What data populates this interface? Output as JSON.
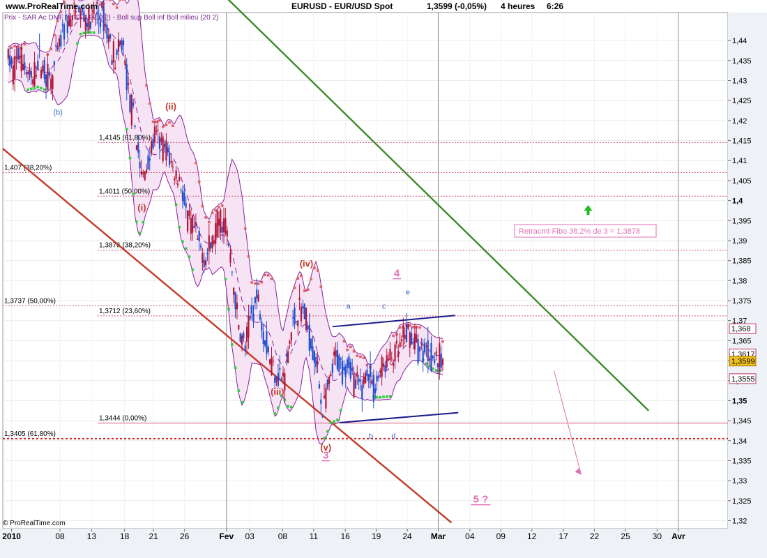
{
  "header": {
    "site": "www.ProRealTime.com",
    "symbol": "EURUSD - EUR/USD Spot",
    "price": "1,3599 (-0,05%)",
    "period": "4 heures",
    "time": "6:26"
  },
  "copyright": "© ProRealTime.com",
  "indicators_label": "Prix - SAR Ac DMF (0,02 0,02 0,2) - Boll sup Boll inf Boll milieu (20 2)",
  "colors": {
    "candle_up": "#1f4fcf",
    "candle_down": "#b0163a",
    "sar_up": "#33cc44",
    "sar_down": "#e0606a",
    "boll_fill": "#f6e4f4",
    "boll_line": "#8a1fa0",
    "channel_green": "#3d8a2a",
    "channel_red": "#c23a2a",
    "wave_label_red": "#c0392b",
    "wave_label_blue": "#3e6fc6",
    "wave_label_pink": "#e06fb4",
    "triangle": "#1a1a8a"
  },
  "chart_data": {
    "type": "candlestick",
    "title": "EURUSD - EUR/USD Spot",
    "timeframe": "4 heures",
    "last_price": 1.3599,
    "change_pct": -0.05,
    "ylim": [
      1.318,
      1.447
    ],
    "grid": true,
    "x_ticks": [
      "2010",
      "08",
      "13",
      "18",
      "21",
      "26",
      "Fev",
      "03",
      "08",
      "11",
      "16",
      "19",
      "24",
      "Mar",
      "04",
      "09",
      "12",
      "17",
      "22",
      "25",
      "30",
      "Avr"
    ],
    "y_ticks": [
      "1,32",
      "1,325",
      "1,33",
      "1,335",
      "1,34",
      "1,345",
      "1,35",
      "1,355",
      "1,36",
      "1,365",
      "1,37",
      "1,375",
      "1,38",
      "1,385",
      "1,39",
      "1,395",
      "1,4",
      "1,405",
      "1,41",
      "1,415",
      "1,42",
      "1,425",
      "1,43",
      "1,435",
      "1,44"
    ],
    "y_ticks_bold": [
      "1,35",
      "1,4"
    ],
    "price_tags": [
      {
        "label": "1,368",
        "value": 1.368
      },
      {
        "label": "1,3617",
        "value": 1.3617
      },
      {
        "label": "1,3599",
        "value": 1.3599,
        "highlight": true
      },
      {
        "label": "1,3555",
        "value": 1.3555
      }
    ],
    "fib_levels": [
      {
        "label": "1,4145 (61,80%)",
        "value": 1.4145,
        "style": "dotted",
        "start": "18"
      },
      {
        "label": "1,407 (38,20%)",
        "value": 1.407,
        "style": "dotted",
        "start": "2010"
      },
      {
        "label": "1,4011 (50,00%)",
        "value": 1.4011,
        "style": "dotted",
        "start": "18"
      },
      {
        "label": "1,3876 (38,20%)",
        "value": 1.3876,
        "style": "dotted",
        "start": "18"
      },
      {
        "label": "1,3737 (50,00%)",
        "value": 1.3737,
        "style": "dotted",
        "start": "2010"
      },
      {
        "label": "1,3712 (23,60%)",
        "value": 1.3712,
        "style": "dotted",
        "start": "18"
      },
      {
        "label": "1,3444 (0,00%)",
        "value": 1.3444,
        "style": "solid",
        "start": "18"
      },
      {
        "label": "1,3405 (61,80%)",
        "value": 1.3405,
        "style": "bold-dotted",
        "start": "2010"
      }
    ],
    "annotation_box": "Retracmt Fibo 38,2% de 3 = 1,3878",
    "wave_labels": [
      {
        "text": "(b)",
        "day": 8,
        "value": 1.4215,
        "color": "blue"
      },
      {
        "text": "(ii)",
        "day": 25.5,
        "value": 1.4228,
        "color": "red"
      },
      {
        "text": "(i)",
        "day": 21,
        "value": 1.3975,
        "color": "red"
      },
      {
        "text": "(iii)",
        "day": 42,
        "value": 1.3515,
        "color": "red"
      },
      {
        "text": "(iv)",
        "day": 46.5,
        "value": 1.3835,
        "color": "red"
      },
      {
        "text": "(v)",
        "day": 49.5,
        "value": 1.3375,
        "color": "red"
      },
      {
        "text": "3",
        "day": 49.5,
        "value": 1.3355,
        "color": "pink",
        "underline": true
      },
      {
        "text": "4",
        "day": 60.5,
        "value": 1.381,
        "color": "pink",
        "underline": true
      },
      {
        "text": "a",
        "day": 53,
        "value": 1.373,
        "color": "blue"
      },
      {
        "text": "b",
        "day": 56.5,
        "value": 1.3405,
        "color": "blue"
      },
      {
        "text": "c",
        "day": 58.5,
        "value": 1.373,
        "color": "blue"
      },
      {
        "text": "d",
        "day": 60,
        "value": 1.3405,
        "color": "blue"
      },
      {
        "text": "e",
        "day": 62.2,
        "value": 1.3765,
        "color": "blue"
      },
      {
        "text": "5 ?",
        "day": 73.5,
        "value": 1.3245,
        "color": "pink",
        "underline": true
      }
    ],
    "trendlines": [
      {
        "name": "upper-channel",
        "from": [
          24,
          1.4655
        ],
        "to": [
          95,
          1.3475
        ],
        "color": "green"
      },
      {
        "name": "lower-channel",
        "from": [
          0,
          1.413
        ],
        "to": [
          66,
          1.3195
        ],
        "color": "red"
      },
      {
        "name": "triangle-top",
        "from": [
          48.5,
          1.3685
        ],
        "to": [
          66.5,
          1.3713
        ],
        "color": "navy"
      },
      {
        "name": "triangle-bottom",
        "from": [
          49.5,
          1.3445
        ],
        "to": [
          67,
          1.347
        ],
        "color": "navy"
      }
    ],
    "forecast_arrow": {
      "from": [
        70,
        1.3575
      ],
      "to": [
        74,
        1.3315
      ]
    },
    "up_arrow": {
      "day": 74,
      "value": 1.3975
    },
    "series": [
      {
        "name": "EURUSD",
        "type": "candlestick",
        "close_path": [
          [
            0,
            1.438
          ],
          [
            1,
            1.432
          ],
          [
            2,
            1.437
          ],
          [
            3,
            1.433
          ],
          [
            4,
            1.429
          ],
          [
            5,
            1.436
          ],
          [
            6,
            1.432
          ],
          [
            7,
            1.43
          ],
          [
            8,
            1.437
          ],
          [
            9,
            1.443
          ],
          [
            11,
            1.447
          ],
          [
            13,
            1.445
          ],
          [
            15,
            1.446
          ],
          [
            16,
            1.44
          ],
          [
            17,
            1.435
          ],
          [
            18,
            1.44
          ],
          [
            19,
            1.426
          ],
          [
            20,
            1.418
          ],
          [
            21,
            1.405
          ],
          [
            22,
            1.41
          ],
          [
            23,
            1.416
          ],
          [
            24,
            1.414
          ],
          [
            25,
            1.412
          ],
          [
            26,
            1.407
          ],
          [
            27,
            1.405
          ],
          [
            28,
            1.395
          ],
          [
            29,
            1.393
          ],
          [
            30,
            1.388
          ],
          [
            31,
            1.386
          ],
          [
            32,
            1.39
          ],
          [
            33,
            1.396
          ],
          [
            34,
            1.394
          ],
          [
            35,
            1.382
          ],
          [
            36,
            1.368
          ],
          [
            37,
            1.363
          ],
          [
            38,
            1.372
          ],
          [
            39,
            1.376
          ],
          [
            40,
            1.366
          ],
          [
            41,
            1.36
          ],
          [
            42,
            1.357
          ],
          [
            43,
            1.355
          ],
          [
            44,
            1.366
          ],
          [
            45,
            1.372
          ],
          [
            46,
            1.373
          ],
          [
            47,
            1.366
          ],
          [
            48,
            1.36
          ],
          [
            49,
            1.348
          ],
          [
            50,
            1.353
          ],
          [
            51,
            1.361
          ],
          [
            52,
            1.358
          ],
          [
            53,
            1.36
          ],
          [
            54,
            1.354
          ],
          [
            55,
            1.353
          ],
          [
            56,
            1.358
          ],
          [
            57,
            1.352
          ],
          [
            58,
            1.358
          ],
          [
            59,
            1.36
          ],
          [
            60,
            1.361
          ],
          [
            61,
            1.363
          ],
          [
            62,
            1.367
          ],
          [
            63,
            1.366
          ],
          [
            64,
            1.362
          ],
          [
            65,
            1.363
          ],
          [
            66,
            1.361
          ],
          [
            67,
            1.36
          ]
        ]
      }
    ]
  }
}
